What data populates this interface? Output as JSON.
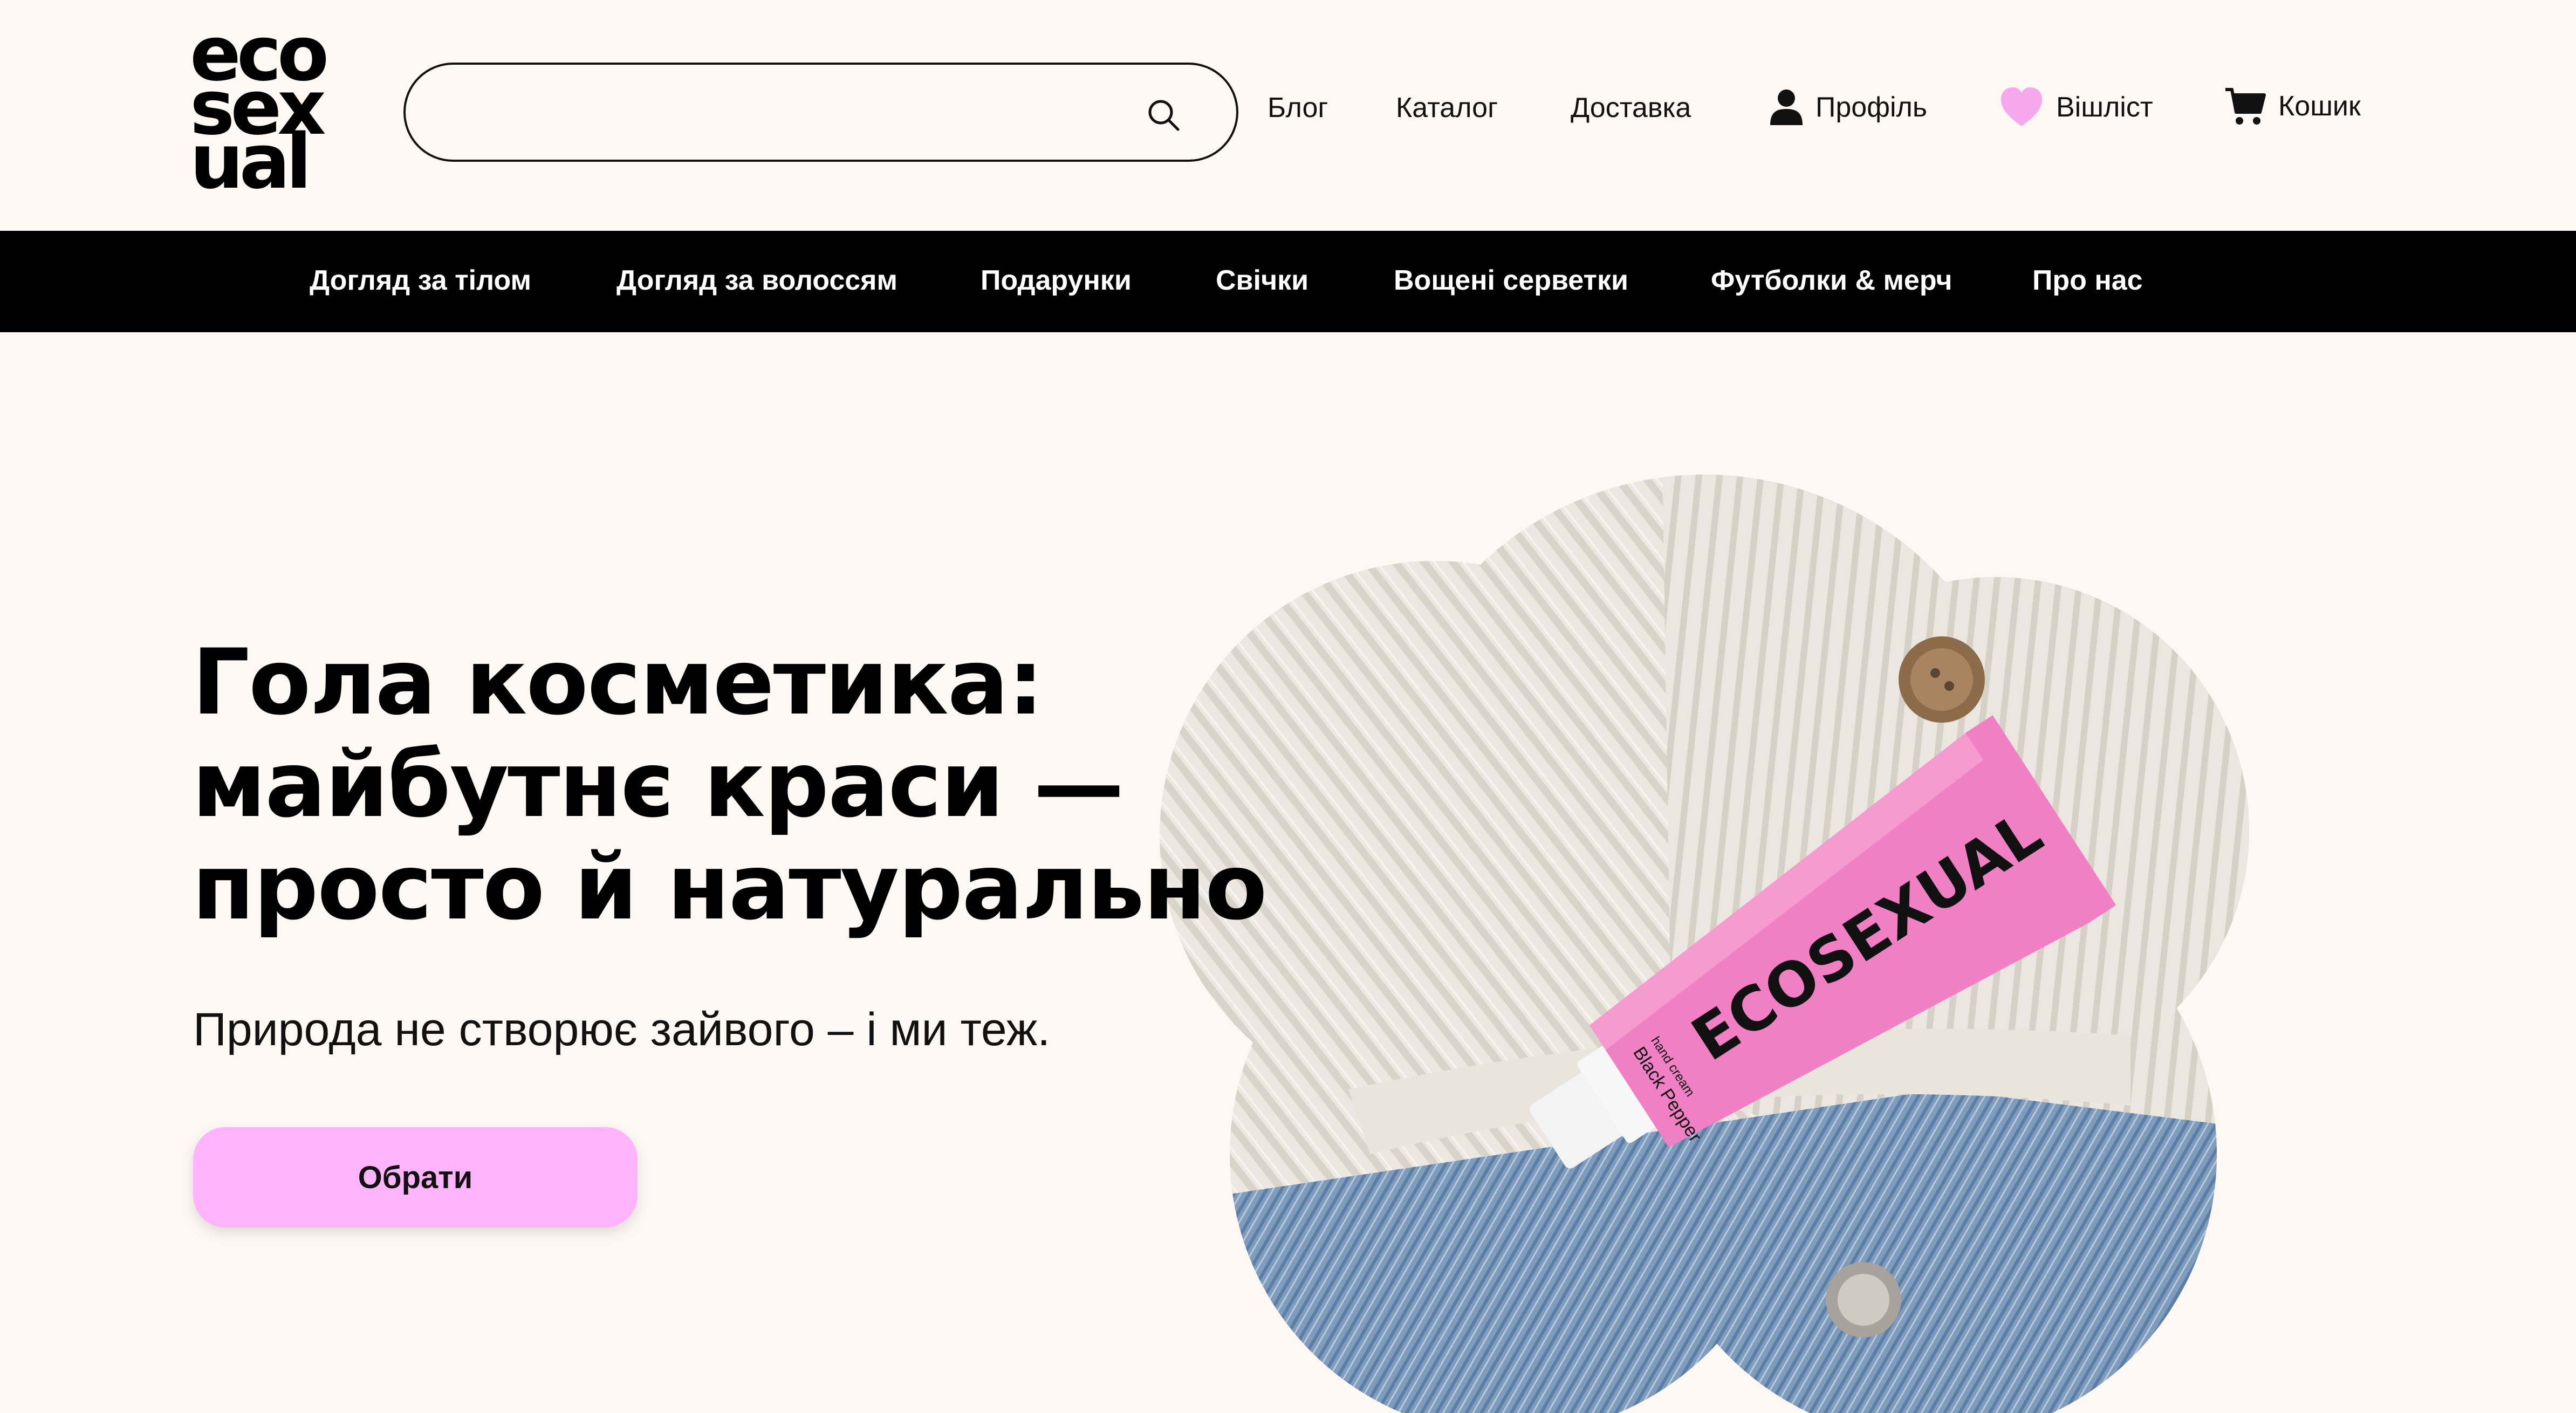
{
  "brand": {
    "logo_lines": [
      "eco",
      "sex",
      "ual"
    ]
  },
  "search": {
    "value": "",
    "placeholder": "",
    "icon": "search-icon"
  },
  "top_nav": {
    "blog": "Блог",
    "catalog": "Каталог",
    "delivery": "Доставка",
    "profile": "Профіль",
    "wishlist": "Вішліст",
    "cart": "Кошик"
  },
  "categories": [
    "Догляд за тілом",
    "Догляд за волоссям",
    "Подарунки",
    "Свічки",
    "Вощені серветки",
    "Футболки & мерч",
    "Про нас"
  ],
  "hero": {
    "title_lines": [
      "Гола косметика:",
      "майбутнє краси —",
      "просто й натурально"
    ],
    "subtitle": "Природа не створює зайвого – і ми теж.",
    "cta_label": "Обрати",
    "product": {
      "brand_on_tube": "ECOSEXUAL",
      "name_on_tube": "Black Pepper",
      "type_on_tube": "hand cream"
    }
  },
  "colors": {
    "background": "#fdf8f3",
    "category_bar": "#000000",
    "accent_pink": "#ffb3fb",
    "wishlist_heart": "#f7a8ec",
    "tube_pink": "#f07fc3"
  }
}
